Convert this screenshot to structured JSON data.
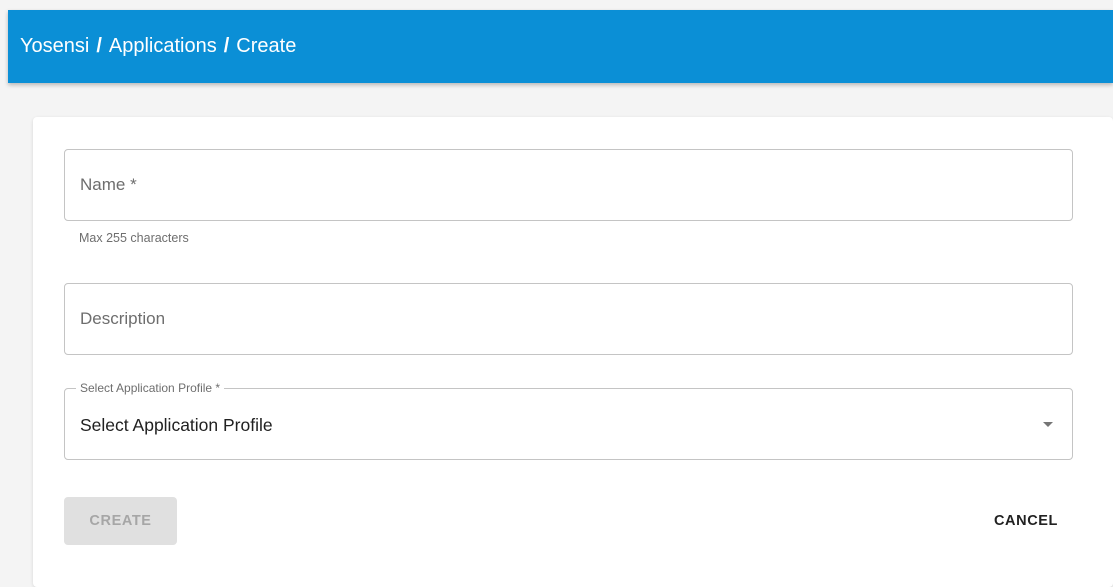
{
  "header": {
    "breadcrumb": [
      "Yosensi",
      "Applications",
      "Create"
    ],
    "separator": "/"
  },
  "form": {
    "name_field": {
      "placeholder": "Name *",
      "value": "",
      "helper": "Max 255 characters"
    },
    "description_field": {
      "placeholder": "Description",
      "value": ""
    },
    "profile_select": {
      "label": "Select Application Profile *",
      "selected": "Select Application Profile",
      "icon": "caret-down-icon"
    },
    "create_label": "CREATE",
    "create_disabled": true,
    "cancel_label": "CANCEL"
  },
  "colors": {
    "app_bar": "#0b8fd6",
    "disabled_button": "#e0e0e0"
  }
}
